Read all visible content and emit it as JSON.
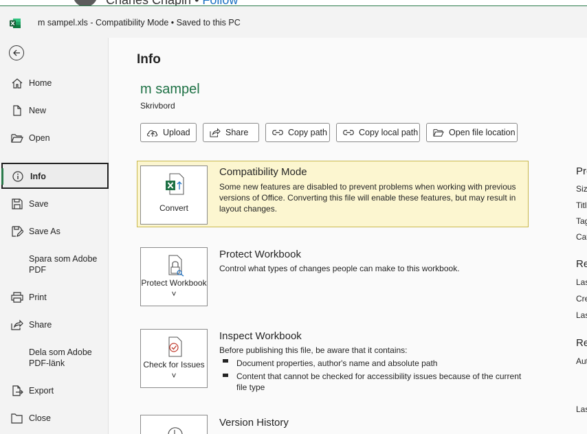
{
  "background_window": {
    "author_text": "Charles Chapin",
    "separator": "•",
    "follow_label": "Follow"
  },
  "titlebar": {
    "app_icon": "excel-icon",
    "title": "m sampel.xls  -  Compatibility Mode  •  Saved to this PC"
  },
  "sidebar": {
    "back_icon": "back-arrow-icon",
    "items": [
      {
        "label": "Home",
        "icon": "home-icon"
      },
      {
        "label": "New",
        "icon": "new-file-icon"
      },
      {
        "label": "Open",
        "icon": "folder-open-icon"
      },
      {
        "label": "Info",
        "icon": "info-icon",
        "active": true
      },
      {
        "label": "Save",
        "icon": "save-icon"
      },
      {
        "label": "Save As",
        "icon": "save-as-icon"
      },
      {
        "label": "Spara som Adobe PDF",
        "icon": ""
      },
      {
        "label": "Print",
        "icon": "print-icon"
      },
      {
        "label": "Share",
        "icon": "share-icon"
      },
      {
        "label": "Dela som Adobe PDF-länk",
        "icon": ""
      },
      {
        "label": "Export",
        "icon": "export-icon"
      },
      {
        "label": "Close",
        "icon": "close-folder-icon"
      }
    ]
  },
  "main": {
    "heading": "Info",
    "file_name": "m sampel",
    "file_location": "Skrivbord",
    "actions": [
      {
        "label": "Upload",
        "icon": "upload-icon"
      },
      {
        "label": "Share",
        "icon": "share-icon"
      },
      {
        "label": "Copy path",
        "icon": "link-icon"
      },
      {
        "label": "Copy local path",
        "icon": "link-icon"
      },
      {
        "label": "Open file location",
        "icon": "folder-icon"
      }
    ],
    "sections": {
      "compat": {
        "tile_label": "Convert",
        "title": "Compatibility Mode",
        "description": "Some new features are disabled to prevent problems when working with previous versions of Office. Converting this file will enable these features, but may result in layout changes."
      },
      "protect": {
        "tile_label": "Protect Workbook ˅",
        "title": "Protect Workbook",
        "description": "Control what types of changes people can make to this workbook."
      },
      "inspect": {
        "tile_label": "Check for Issues ˅",
        "title": "Inspect Workbook",
        "description": "Before publishing this file, be aware that it contains:",
        "bullets": [
          "Document properties, author's name and absolute path",
          "Content that cannot be checked for accessibility issues because of the current file type"
        ]
      },
      "version": {
        "title": "Version History"
      }
    },
    "properties_clipped": {
      "heading": "Pro",
      "rows": [
        "Size",
        "Title",
        "Tag",
        "Cat"
      ],
      "related_dates": "Re",
      "date_rows": [
        "Las",
        "Cre",
        "Las"
      ],
      "related_people": "Re",
      "people_rows": [
        "Aut"
      ],
      "last_row": "Las"
    }
  }
}
